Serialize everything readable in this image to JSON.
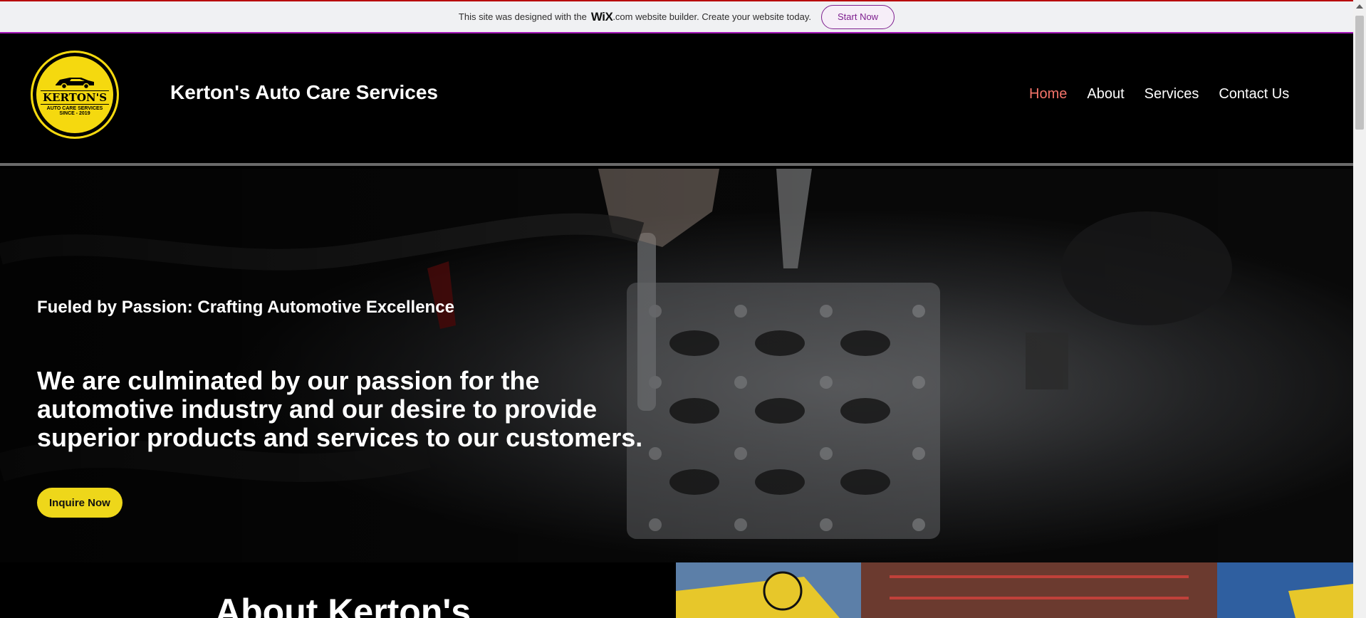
{
  "wix_banner": {
    "text_before": "This site was designed with the",
    "wix_logo": "WiX",
    "text_after": ".com website builder. Create your website today.",
    "start_button": "Start Now"
  },
  "header": {
    "logo": {
      "name": "KERTON'S",
      "tagline": "AUTO CARE SERVICES",
      "since": "SINCE - 2019"
    },
    "site_title": "Kerton's Auto Care Services",
    "nav": [
      {
        "label": "Home",
        "active": true
      },
      {
        "label": "About",
        "active": false
      },
      {
        "label": "Services",
        "active": false
      },
      {
        "label": "Contact Us",
        "active": false
      }
    ]
  },
  "hero": {
    "subtitle": "Fueled by Passion: Crafting Automotive Excellence",
    "headline": "We are culminated by our passion for the automotive industry and our desire to provide superior products and services to our customers.",
    "cta": "Inquire Now"
  },
  "about": {
    "title": "About Kerton's"
  },
  "colors": {
    "accent_nav": "#f5746a",
    "cta_yellow": "#eed71a",
    "logo_yellow": "#f5d90f",
    "banner_purple": "#7e1f8f"
  }
}
